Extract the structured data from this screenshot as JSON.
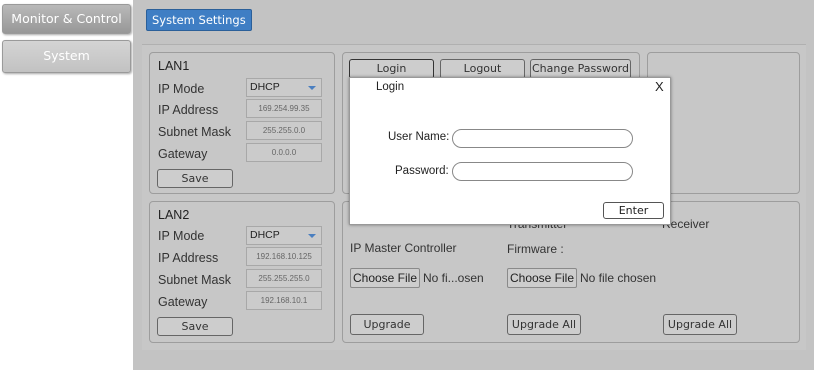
{
  "nav": {
    "monitor_label": "Monitor & Control",
    "system_label": "System"
  },
  "tab": {
    "label": "System Settings"
  },
  "lan1": {
    "title": "LAN1",
    "ip_mode_label": "IP Mode",
    "ip_mode_value": "DHCP",
    "ip_address_label": "IP Address",
    "ip_address_value": "169.254.99.35",
    "subnet_label": "Subnet Mask",
    "subnet_value": "255.255.0.0",
    "gateway_label": "Gateway",
    "gateway_value": "0.0.0.0",
    "save_label": "Save"
  },
  "lan2": {
    "title": "LAN2",
    "ip_mode_label": "IP Mode",
    "ip_mode_value": "DHCP",
    "ip_address_label": "IP Address",
    "ip_address_value": "192.168.10.125",
    "subnet_label": "Subnet Mask",
    "subnet_value": "255.255.255.0",
    "gateway_label": "Gateway",
    "gateway_value": "192.168.10.1",
    "save_label": "Save"
  },
  "account": {
    "login_label": "Login",
    "logout_label": "Logout",
    "change_password_label": "Change Password"
  },
  "upgrade": {
    "transmitter_label": "Transmitter",
    "receiver_label": "Receiver",
    "ip_master_label": "IP Master Controller",
    "firmware_label": "Firmware :",
    "choose_file_label": "Choose File",
    "file_status_short": "No fi...osen",
    "file_status_long": "No file chosen",
    "upgrade_label": "Upgrade",
    "upgrade_all_label": "Upgrade All",
    "upgrade_all_label_2": "Upgrade All"
  },
  "modal": {
    "title": "Login",
    "close_glyph": "X",
    "username_label": "User Name:",
    "password_label": "Password:",
    "enter_label": "Enter"
  }
}
